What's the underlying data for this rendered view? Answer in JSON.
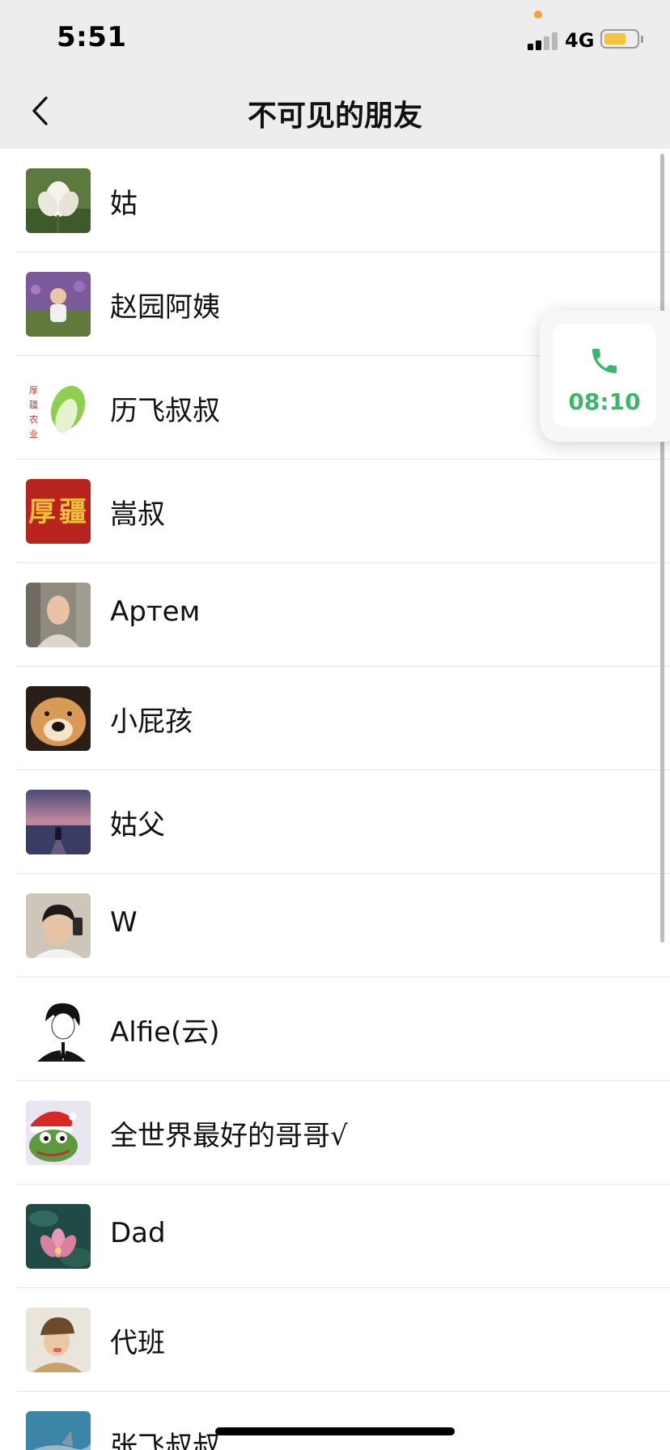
{
  "status_bar": {
    "time": "5:51",
    "network": "4G",
    "recording_dot_color": "#f0a23b",
    "battery_level": 0.6,
    "battery_color": "#f6c33d",
    "signal_bars_active": 2
  },
  "nav": {
    "back_icon": "chevron-left-icon",
    "title": "不可见的朋友"
  },
  "contacts": [
    {
      "name": "姑"
    },
    {
      "name": "赵园阿姨"
    },
    {
      "name": "历飞叔叔",
      "avatar_text": [
        "厚",
        "疆",
        "农",
        "业"
      ]
    },
    {
      "name": "嵩叔",
      "avatar_text": [
        "厚",
        "疆"
      ]
    },
    {
      "name": "Артем"
    },
    {
      "name": "小屁孩"
    },
    {
      "name": "姑父"
    },
    {
      "name": "W"
    },
    {
      "name": "Alfie(云)"
    },
    {
      "name": "全世界最好的哥哥√"
    },
    {
      "name": "Dad"
    },
    {
      "name": "代班"
    },
    {
      "name": "张飞叔叔"
    }
  ],
  "floating_call": {
    "icon": "phone-icon",
    "duration": "08:10",
    "accent_color": "#3cb66a"
  }
}
